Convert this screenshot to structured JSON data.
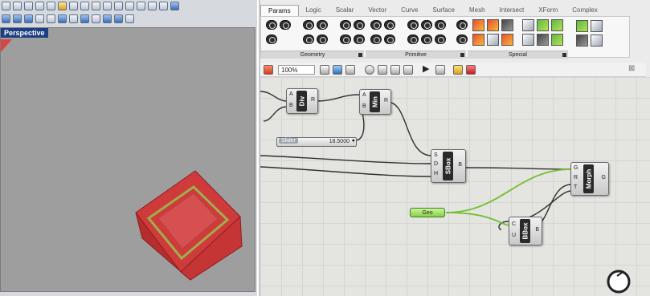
{
  "rhino": {
    "viewport_label": "Perspective"
  },
  "gh": {
    "tabs": [
      "Params",
      "Logic",
      "Scalar",
      "Vector",
      "Curve",
      "Surface",
      "Mesh",
      "Intersect",
      "XForm",
      "Complex"
    ],
    "active_tab": "Params",
    "groups": [
      "Geometry",
      "Primitive",
      "Special"
    ],
    "zoom": "100%",
    "components": {
      "div": {
        "name": "Div",
        "inputs": [
          "A",
          "B"
        ],
        "output": "R"
      },
      "min": {
        "name": "Min",
        "inputs": [
          "A",
          "B"
        ],
        "output": "R"
      },
      "sbox": {
        "name": "SBox",
        "inputs": [
          "S",
          "D",
          "H"
        ],
        "output": "B"
      },
      "morph": {
        "name": "Morph",
        "inputs": [
          "G",
          "R",
          "T"
        ],
        "output": "G"
      },
      "bbox": {
        "name": "BBox",
        "inputs": [
          "C",
          "U"
        ],
        "output": "B"
      }
    },
    "slider": {
      "label": "Slider",
      "value": "18.5000"
    },
    "geo": {
      "label": "Geo"
    }
  },
  "colors": {
    "viewport_label_bg": "#1c3f84",
    "box": "#d84545",
    "wire_green": "#6fbf2e",
    "geo_param": "#87d146"
  }
}
